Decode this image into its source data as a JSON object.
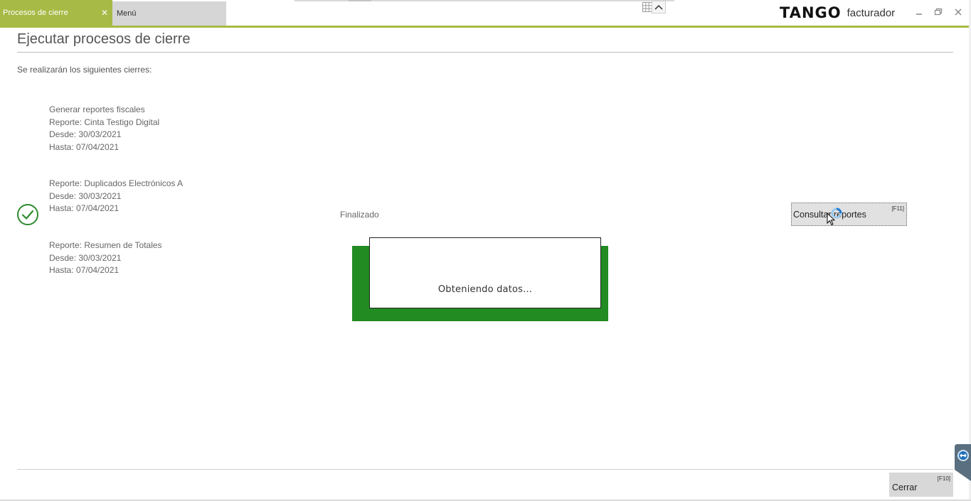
{
  "tabs": {
    "active_label": "Procesos de cierre",
    "inactive_label": "Menú",
    "close_symbol": "✕"
  },
  "brand": {
    "logo_text": "TANGO",
    "app_name": "facturador"
  },
  "window_controls": {
    "minimize_icon": "minimize-icon",
    "restore_icon": "restore-icon",
    "close_icon": "close-icon"
  },
  "page": {
    "title": "Ejecutar procesos de cierre",
    "intro": "Se realizarán los siguientes cierres:"
  },
  "blocks": [
    {
      "lines": [
        "Generar reportes fiscales",
        "Reporte: Cinta Testigo Digital",
        "Desde: 30/03/2021",
        "Hasta: 07/04/2021"
      ]
    },
    {
      "lines": [
        "Reporte: Duplicados Electrónicos A",
        "Desde: 30/03/2021",
        "Hasta: 07/04/2021"
      ]
    },
    {
      "lines": [
        "Reporte: Resumen de Totales",
        "Desde: 30/03/2021",
        "Hasta: 07/04/2021"
      ]
    }
  ],
  "status": {
    "text": "Finalizado",
    "icon": "check-circle-icon",
    "color": "#2e8b2e"
  },
  "buttons": {
    "consult_label": "Consultar reportes",
    "consult_hotkey": "[F11]",
    "close_label": "Cerrar",
    "close_hotkey": "[F10]"
  },
  "progress_dialog": {
    "message": "Obteniendo datos..."
  },
  "colors": {
    "accent": "#a6ba45",
    "dialog_frame": "#228b22"
  }
}
